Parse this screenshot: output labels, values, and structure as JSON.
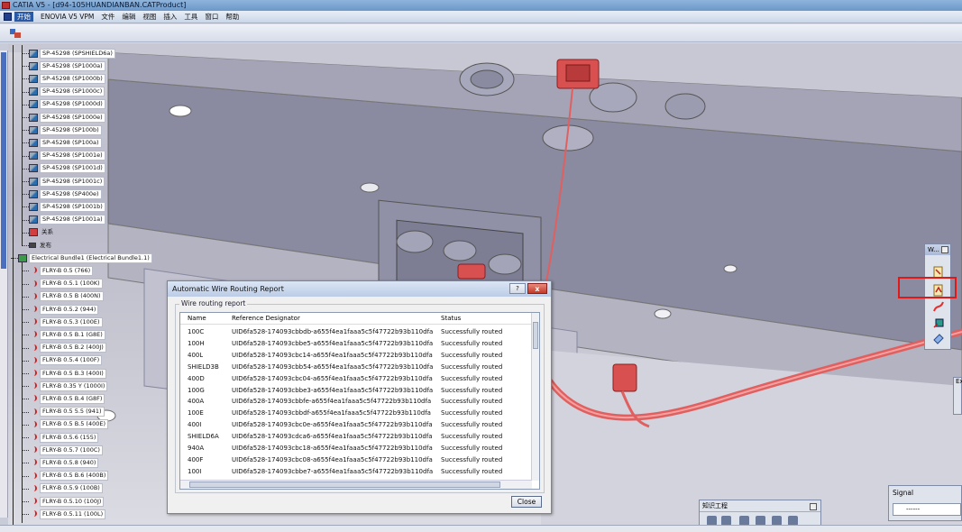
{
  "window": {
    "title": "CATIA V5 - [d94-105HUANDIANBAN.CATProduct]"
  },
  "menu": {
    "items": [
      {
        "label": "开始"
      },
      {
        "label": "ENOVIA V5 VPM"
      },
      {
        "label": "文件"
      },
      {
        "label": "编辑"
      },
      {
        "label": "视图"
      },
      {
        "label": "插入"
      },
      {
        "label": "工具"
      },
      {
        "label": "窗口"
      },
      {
        "label": "帮助"
      }
    ]
  },
  "tree": {
    "parts": [
      "SP-45298 (SPSHIELD6a)",
      "SP-45298 (SP1000a)",
      "SP-45298 (SP1000b)",
      "SP-45298 (SP1000c)",
      "SP-45298 (SP1000d)",
      "SP-45298 (SP1000e)",
      "SP-45298 (SP100b)",
      "SP-45298 (SP100a)",
      "SP-45298 (SP1001e)",
      "SP-45298 (SP1001d)",
      "SP-45298 (SP1001c)",
      "SP-45298 (SP400e)",
      "SP-45298 (SP1001b)",
      "SP-45298 (SP1001a)"
    ],
    "relations": "关系",
    "publication": "发布",
    "bundle": "Electrical Bundle1 (Electrical Bundle1.1)",
    "wires": [
      "FLRY-B 0.5 (766)",
      "FLRY-B 0.5.1 (100K)",
      "FLRY-B 0.5 B (400N)",
      "FLRY-B 0.5.2 (944)",
      "FLRY-B 0.5.3 (100E)",
      "FLRY-B 0.5 B.1 (G8E)",
      "FLRY-B 0.5 B.2 (400J)",
      "FLRY-B 0.5.4 (100F)",
      "FLRY-B 0.5 B.3 (400I)",
      "FLRY-B 0.35 Y (1000I)",
      "FLRY-B 0.5 B.4 (G8F)",
      "FLRY-B 0.5 5.5 (941)",
      "FLRY-B 0.5 B.5 (400E)",
      "FLRY-B 0.5.6 (155)",
      "FLRY-B 0.5.7 (100C)",
      "FLRY-B 0.5.8 (940)",
      "FLRY-B 0.5 B.6 (400B)",
      "FLRY-B 0.5.9 (100B)",
      "FLRY-B 0.5.10 (100J)",
      "FLRY-B 0.5.11 (100L)"
    ]
  },
  "wtoolbar": {
    "title": "W..."
  },
  "dialog": {
    "title": "Automatic Wire Routing Report",
    "help_label": "?",
    "close_x": "x",
    "group_title": "Wire routing report",
    "columns": {
      "name": "Name",
      "ref": "Reference Designator",
      "status": "Status"
    },
    "rows": [
      {
        "name": "100C",
        "ref": "UID6fa528-174093cbbdb-a655f4ea1faaa5c5f47722b93b110dfa",
        "status": "Successfully routed"
      },
      {
        "name": "100H",
        "ref": "UID6fa528-174093cbbe5-a655f4ea1faaa5c5f47722b93b110dfa",
        "status": "Successfully routed"
      },
      {
        "name": "400L",
        "ref": "UID6fa528-174093cbc14-a655f4ea1faaa5c5f47722b93b110dfa",
        "status": "Successfully routed"
      },
      {
        "name": "SHIELD3B",
        "ref": "UID6fa528-174093cbb54-a655f4ea1faaa5c5f47722b93b110dfa",
        "status": "Successfully routed"
      },
      {
        "name": "400D",
        "ref": "UID6fa528-174093cbc04-a655f4ea1faaa5c5f47722b93b110dfa",
        "status": "Successfully routed"
      },
      {
        "name": "100G",
        "ref": "UID6fa528-174093cbbe3-a655f4ea1faaa5c5f47722b93b110dfa",
        "status": "Successfully routed"
      },
      {
        "name": "400A",
        "ref": "UID6fa528-174093cbbfe-a655f4ea1faaa5c5f47722b93b110dfa",
        "status": "Successfully routed"
      },
      {
        "name": "100E",
        "ref": "UID6fa528-174093cbbdf-a655f4ea1faaa5c5f47722b93b110dfa",
        "status": "Successfully routed"
      },
      {
        "name": "400I",
        "ref": "UID6fa528-174093cbc0e-a655f4ea1faaa5c5f47722b93b110dfa",
        "status": "Successfully routed"
      },
      {
        "name": "SHIELD6A",
        "ref": "UID6fa528-174093cdca6-a655f4ea1faaa5c5f47722b93b110dfa",
        "status": "Successfully routed"
      },
      {
        "name": "940A",
        "ref": "UID6fa528-174093cbc18-a655f4ea1faaa5c5f47722b93b110dfa",
        "status": "Successfully routed"
      },
      {
        "name": "400F",
        "ref": "UID6fa528-174093cbc08-a655f4ea1faaa5c5f47722b93b110dfa",
        "status": "Successfully routed"
      },
      {
        "name": "100I",
        "ref": "UID6fa528-174093cbbe7-a655f4ea1faaa5c5f47722b93b110dfa",
        "status": "Successfully routed"
      }
    ],
    "close_button": "Close"
  },
  "knowledge_toolbar": {
    "title": "知识工程"
  },
  "signal_toolbar": {
    "title": "Signal",
    "value": "------"
  },
  "exp_toolbar": {
    "title": "Ex"
  },
  "colors": {
    "wire": "#e06060",
    "highlight_box": "#e01818",
    "connector": "#d85050"
  }
}
